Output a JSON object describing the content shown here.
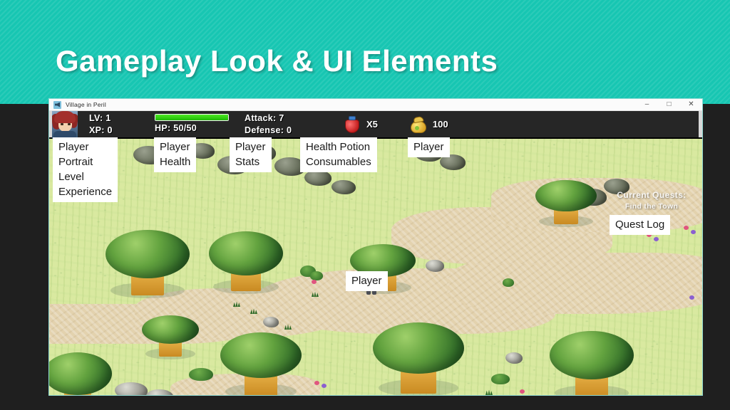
{
  "slide": {
    "title": "Gameplay Look & UI Elements",
    "banner_color": "#17c6b2",
    "background_color": "#1f1f1f"
  },
  "game_window": {
    "titlebar": {
      "app_icon": "game-app-icon",
      "title": "Village in Peril",
      "minimize": "–",
      "maximize": "□",
      "close": "✕"
    },
    "hud": {
      "portrait_alt": "player-portrait",
      "level_label": "LV: 1",
      "xp_label": "XP: 0",
      "hp_label": "HP: 50/50",
      "hp_percent": 100,
      "hp_bar_color": "#2ecc0e",
      "attack_label": "Attack: 7",
      "defense_label": "Defense: 0",
      "potion_icon": "health-potion-icon",
      "potion_count": "X5",
      "gold_icon": "gold-bag-icon",
      "gold_count": "100"
    },
    "scene": {
      "quest_title": "Current Quests:",
      "quest_items": [
        "Find the Town"
      ],
      "player_sprite_alt": "player-character-sprite"
    }
  },
  "callouts": {
    "portrait": "Player\nPortrait\nLevel\nExperience",
    "health": "Player\nHealth",
    "stats": "Player\nStats",
    "potion": "Health Potion\nConsumables",
    "gold": "Player",
    "quest": "Quest Log",
    "player": "Player"
  }
}
